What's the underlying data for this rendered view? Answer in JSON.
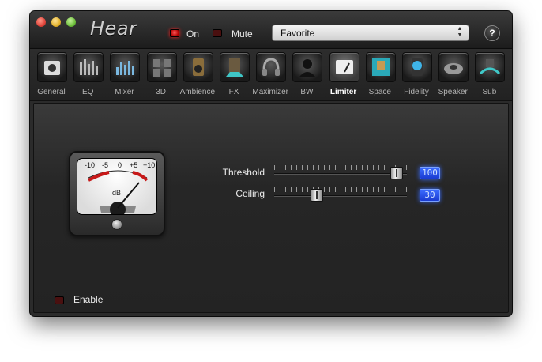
{
  "app": {
    "title": "Hear"
  },
  "toolbar": {
    "on_label": "On",
    "mute_label": "Mute",
    "on_state": true,
    "mute_state": false,
    "preset_value": "Favorite",
    "help_label": "?"
  },
  "tabs": [
    {
      "label": "General",
      "icon": "speaker-box-icon"
    },
    {
      "label": "EQ",
      "icon": "equalizer-icon"
    },
    {
      "label": "Mixer",
      "icon": "mixer-icon"
    },
    {
      "label": "3D",
      "icon": "speakers-3d-icon"
    },
    {
      "label": "Ambience",
      "icon": "ambience-speaker-icon"
    },
    {
      "label": "FX",
      "icon": "fx-speaker-icon"
    },
    {
      "label": "Maximizer",
      "icon": "headphones-icon"
    },
    {
      "label": "BW",
      "icon": "listener-head-icon"
    },
    {
      "label": "Limiter",
      "icon": "vu-meter-icon",
      "active": true
    },
    {
      "label": "Space",
      "icon": "room-space-icon"
    },
    {
      "label": "Fidelity",
      "icon": "tweeter-icon"
    },
    {
      "label": "Speaker",
      "icon": "speaker-disc-icon"
    },
    {
      "label": "Sub",
      "icon": "subwoofer-icon"
    }
  ],
  "limiter": {
    "meter": {
      "scale": [
        "-10",
        "-5",
        "0",
        "+5",
        "+10"
      ],
      "unit": "dB"
    },
    "threshold": {
      "label": "Threshold",
      "value": "100",
      "fraction": 0.97
    },
    "ceiling": {
      "label": "Ceiling",
      "value": "30",
      "fraction": 0.3
    },
    "enable": {
      "label": "Enable",
      "checked": false
    }
  },
  "colors": {
    "accent_blue": "#2a52f0",
    "led_red": "#d00000",
    "active_tab_text": "#ffffff"
  }
}
